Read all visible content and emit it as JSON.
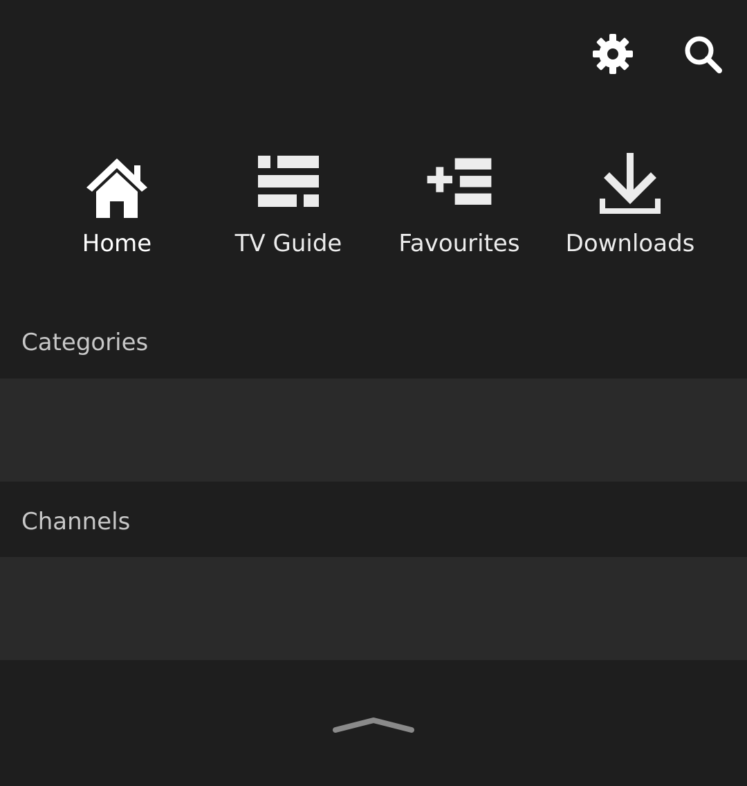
{
  "header": {
    "settings_icon": "gear-icon",
    "search_icon": "search-icon",
    "icon_color": "#ffffff"
  },
  "nav": {
    "items": [
      {
        "label": "Home",
        "icon": "home-icon",
        "active": true
      },
      {
        "label": "TV Guide",
        "icon": "tv-guide-icon",
        "active": false
      },
      {
        "label": "Favourites",
        "icon": "favourites-add-icon",
        "active": false
      },
      {
        "label": "Downloads",
        "icon": "download-icon",
        "active": false
      }
    ]
  },
  "sections": {
    "categories": {
      "title": "Categories"
    },
    "channels": {
      "title": "Channels"
    }
  },
  "footer": {
    "expand_icon": "chevron-up-icon"
  },
  "colors": {
    "background": "#1e1e1e",
    "panel": "#2a2a2a",
    "section_title": "#c8c8c8",
    "text": "#ffffff",
    "handle": "#8a8a8a"
  }
}
